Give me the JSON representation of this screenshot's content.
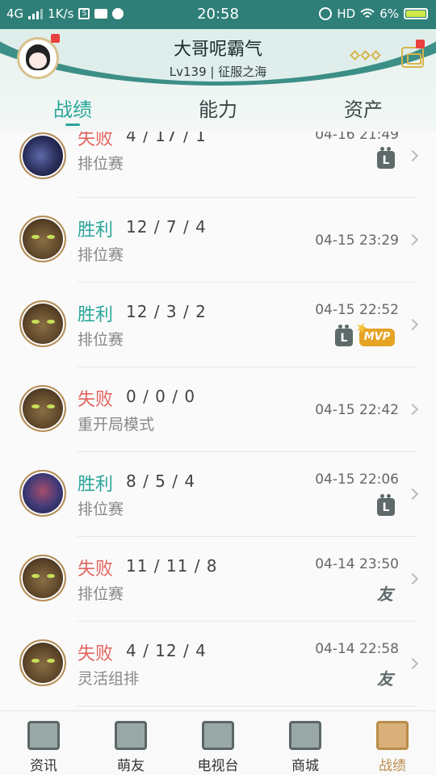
{
  "status_bar": {
    "network": "4G",
    "speed": "1K/s",
    "time": "20:58",
    "hd": "HD",
    "battery": "6%"
  },
  "profile": {
    "name": "大哥呢霸气",
    "level_line": "Lv139 | 征服之海"
  },
  "tabs": [
    {
      "label": "战绩",
      "active": true
    },
    {
      "label": "能力",
      "active": false
    },
    {
      "label": "资产",
      "active": false
    }
  ],
  "matches": [
    {
      "result": "失败",
      "outcome": "lose",
      "kda": "4 / 17 / 1",
      "mode": "排位赛",
      "time": "04-16 21:49",
      "champion_icon": "dark-assassin-icon",
      "tags": [
        "L"
      ]
    },
    {
      "result": "胜利",
      "outcome": "win",
      "kda": "12 / 7 / 4",
      "mode": "排位赛",
      "time": "04-15 23:29",
      "champion_icon": "ogre-icon",
      "tags": []
    },
    {
      "result": "胜利",
      "outcome": "win",
      "kda": "12 / 3 / 2",
      "mode": "排位赛",
      "time": "04-15 22:52",
      "champion_icon": "ogre-icon",
      "tags": [
        "L",
        "MVP"
      ]
    },
    {
      "result": "失败",
      "outcome": "lose",
      "kda": "0 / 0 / 0",
      "mode": "重开局模式",
      "time": "04-15 22:42",
      "champion_icon": "ogre-icon",
      "tags": []
    },
    {
      "result": "胜利",
      "outcome": "win",
      "kda": "8 / 5 / 4",
      "mode": "排位赛",
      "time": "04-15 22:06",
      "champion_icon": "purple-mage-icon",
      "tags": [
        "L"
      ]
    },
    {
      "result": "失败",
      "outcome": "lose",
      "kda": "11 / 11 / 8",
      "mode": "排位赛",
      "time": "04-14 23:50",
      "champion_icon": "ogre-icon",
      "tags": [
        "友"
      ]
    },
    {
      "result": "失败",
      "outcome": "lose",
      "kda": "4 / 12 / 4",
      "mode": "灵活组排",
      "time": "04-14 22:58",
      "champion_icon": "ogre-icon",
      "tags": [
        "友"
      ]
    }
  ],
  "tag_labels": {
    "live": "L",
    "mvp": "MVP",
    "friend": "友"
  },
  "bottom_nav": [
    {
      "label": "资讯",
      "icon": "news-book-icon",
      "active": false
    },
    {
      "label": "萌友",
      "icon": "heart-chat-icon",
      "active": false
    },
    {
      "label": "电视台",
      "icon": "tv-channel-icon",
      "active": false
    },
    {
      "label": "商城",
      "icon": "shop-bag-icon",
      "active": false
    },
    {
      "label": "战绩",
      "icon": "record-shield-icon",
      "active": true
    }
  ],
  "colors": {
    "accent": "#2aa59a",
    "win": "#2aa59a",
    "lose": "#e2655f",
    "gold": "#b98c4b",
    "header_teal": "#2e7f78"
  }
}
